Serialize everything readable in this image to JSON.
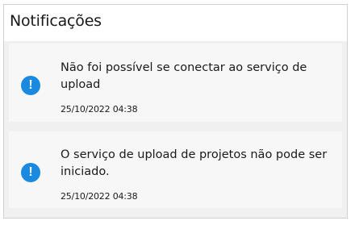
{
  "panel": {
    "title": "Notificações"
  },
  "notifications": [
    {
      "icon": "exclamation-circle-icon",
      "icon_glyph": "!",
      "message": "Não foi possível se conectar ao serviço de upload",
      "timestamp": "25/10/2022 04:38"
    },
    {
      "icon": "exclamation-circle-icon",
      "icon_glyph": "!",
      "message": "O serviço de upload de projetos não pode ser iniciado.",
      "timestamp": "25/10/2022 04:38"
    }
  ],
  "colors": {
    "accent": "#1a8ae0",
    "card_background": "#f7f7f7",
    "panel_background": "#f0f0f0"
  }
}
